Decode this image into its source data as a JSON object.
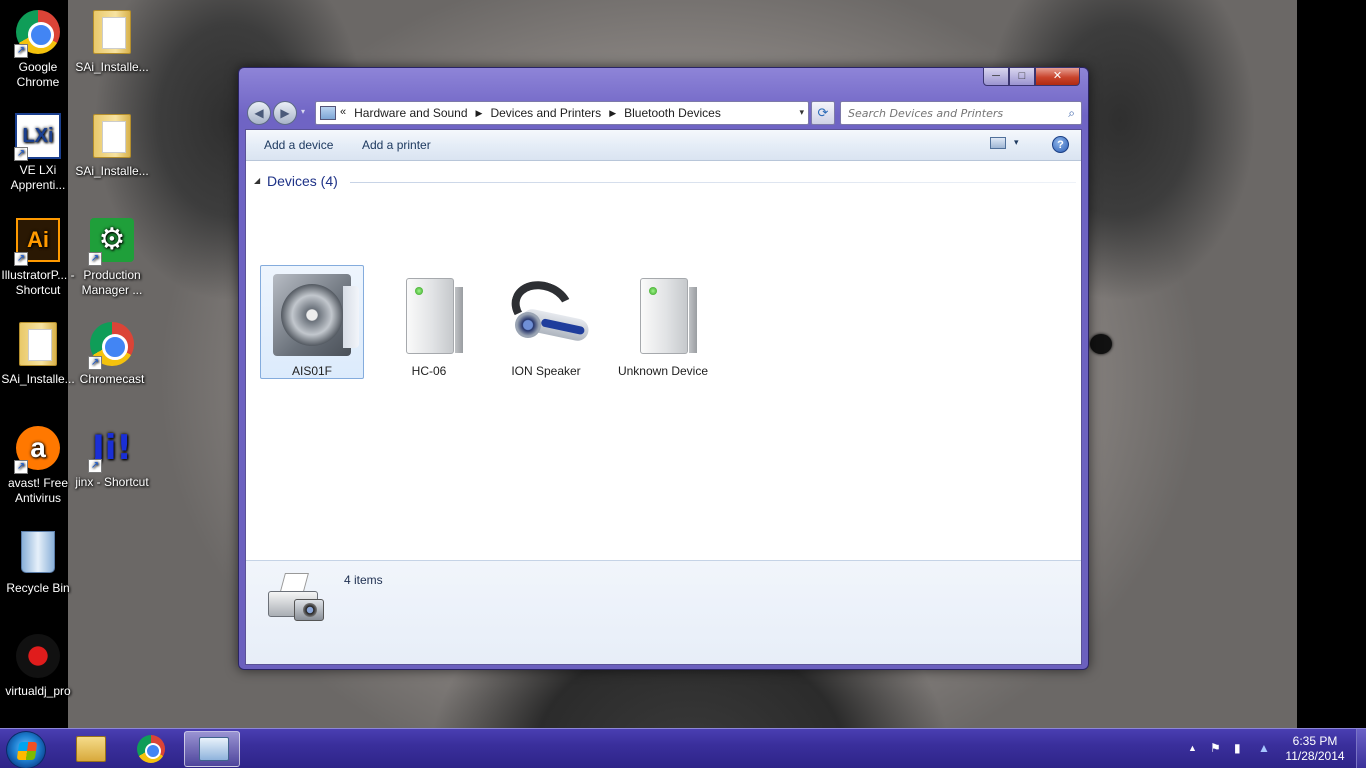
{
  "desktop": {
    "icons": [
      {
        "label": "Google Chrome",
        "icon": "chrome-icon"
      },
      {
        "label": "SAi_Installe...",
        "icon": "folder-icon"
      },
      {
        "label": "VE LXi Apprenti...",
        "icon": "lxi-icon"
      },
      {
        "label": "SAi_Installe...",
        "icon": "folder-icon"
      },
      {
        "label": "IllustratorP... - Shortcut",
        "icon": "illustrator-icon"
      },
      {
        "label": "Production Manager ...",
        "icon": "production-manager-icon"
      },
      {
        "label": "SAi_Installe...",
        "icon": "folder-icon"
      },
      {
        "label": "Chromecast",
        "icon": "chromecast-icon"
      },
      {
        "label": "avast! Free Antivirus",
        "icon": "avast-icon"
      },
      {
        "label": "jinx - Shortcut",
        "icon": "jinx-icon"
      },
      {
        "label": "Recycle Bin",
        "icon": "recycle-bin-icon"
      },
      {
        "label": "virtualdj_pro",
        "icon": "virtualdj-icon"
      }
    ],
    "lxi_text": "LXi",
    "ai_text": "Ai",
    "jinx_text": "Ji!"
  },
  "window": {
    "controls": {
      "minimize": "─",
      "maximize": "□",
      "close": "✕"
    },
    "nav": {
      "back": "◀",
      "forward": "▶",
      "recent": "▾"
    },
    "address": {
      "prefix": "«",
      "crumbs": [
        "Hardware and Sound",
        "Devices and Printers",
        "Bluetooth Devices"
      ],
      "separator": "▶",
      "dropdown": "▾"
    },
    "refresh": "⟳",
    "search": {
      "placeholder": "Search Devices and Printers",
      "value": ""
    },
    "toolbar": {
      "add_device": "Add a device",
      "add_printer": "Add a printer",
      "view_dropdown": "▾",
      "help": "?"
    },
    "group": {
      "collapse": "◢",
      "title": "Devices (4)"
    },
    "devices": [
      {
        "label": "AIS01F",
        "icon": "speaker-icon",
        "selected": true
      },
      {
        "label": "HC-06",
        "icon": "computer-tower-icon",
        "selected": false
      },
      {
        "label": "ION Speaker",
        "icon": "headset-icon",
        "selected": false
      },
      {
        "label": "Unknown Device",
        "icon": "computer-tower-icon",
        "selected": false
      }
    ],
    "details": {
      "count": "4 items",
      "icon": "printer-camera-icon"
    }
  },
  "taskbar": {
    "apps": [
      {
        "name": "windows-explorer",
        "active": false
      },
      {
        "name": "google-chrome",
        "active": false
      },
      {
        "name": "devices-and-printers",
        "active": true
      }
    ],
    "tray": {
      "show_hidden": "▲",
      "flag": "⚑",
      "clock_time": "6:35 PM",
      "clock_date": "11/28/2014"
    }
  },
  "colors": {
    "accent_title": "#1e3287",
    "window_frame": "#6f64c4",
    "taskbar": "#3a2f9c",
    "close_button": "#c9442c"
  }
}
